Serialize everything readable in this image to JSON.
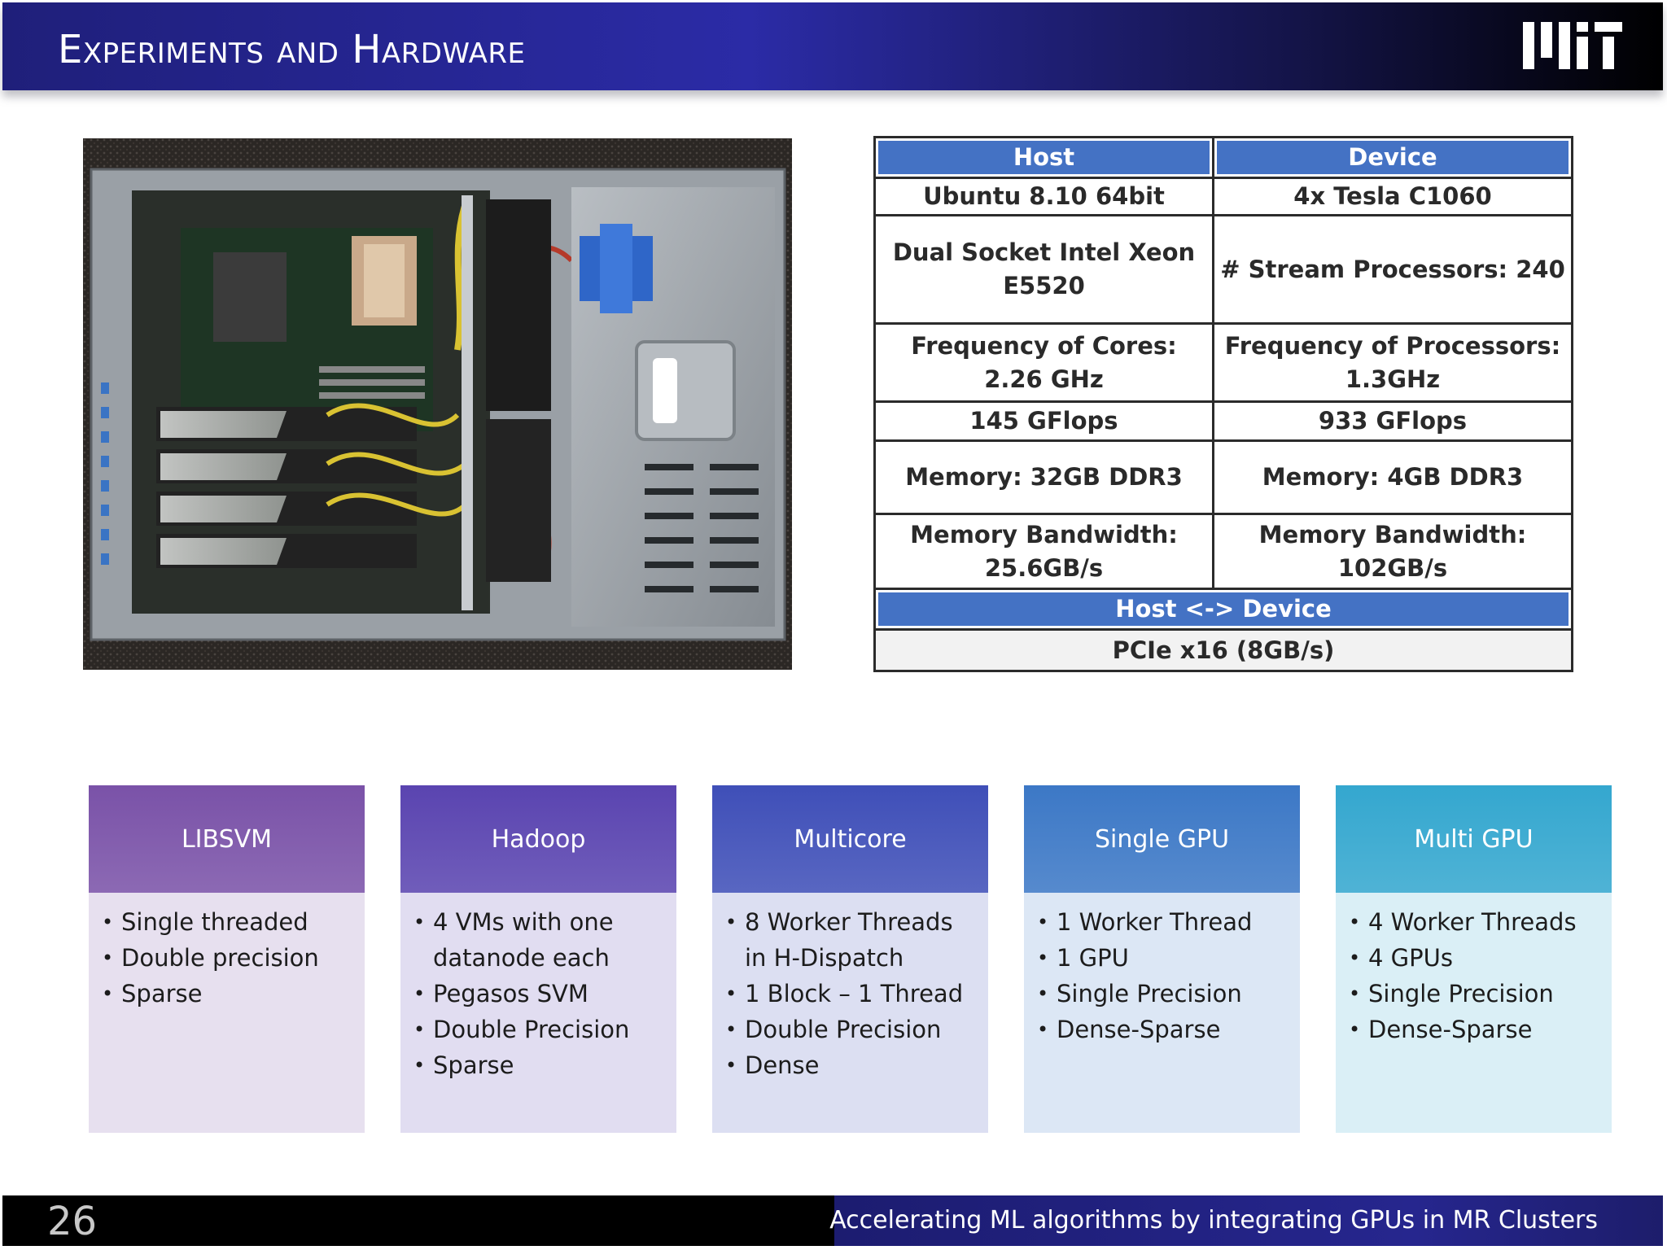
{
  "header": {
    "title": "Experiments and Hardware"
  },
  "spec_table": {
    "header_host": "Host",
    "header_device": "Device",
    "rows": [
      {
        "host": "Ubuntu 8.10 64bit",
        "device": "4x Tesla C1060"
      },
      {
        "host": "Dual Socket Intel Xeon E5520",
        "device": "# Stream Processors: 240"
      },
      {
        "host": "Frequency of Cores: 2.26 GHz",
        "device": "Frequency of Processors: 1.3GHz"
      },
      {
        "host": "145 GFlops",
        "device": "933 GFlops"
      },
      {
        "host": "Memory: 32GB DDR3",
        "device": "Memory: 4GB DDR3"
      },
      {
        "host": "Memory Bandwidth: 25.6GB/s",
        "device": "Memory Bandwidth: 102GB/s"
      }
    ],
    "link_header": "Host <-> Device",
    "link_value": "PCIe x16 (8GB/s)"
  },
  "columns": [
    {
      "title": "LIBSVM",
      "color": "#7a52a8",
      "items": [
        "Single threaded",
        "Double precision",
        "Sparse"
      ]
    },
    {
      "title": "Hadoop",
      "color": "#5a44b0",
      "items": [
        "4 VMs with one datanode each",
        "Pegasos SVM",
        "Double Precision",
        "Sparse"
      ]
    },
    {
      "title": "Multicore",
      "color": "#3f4fb8",
      "items": [
        "8 Worker Threads in H-Dispatch",
        "1 Block – 1 Thread",
        "Double Precision",
        "Dense"
      ]
    },
    {
      "title": "Single GPU",
      "color": "#3c78c6",
      "items": [
        "1 Worker Thread",
        "1 GPU",
        "Single Precision",
        "Dense-Sparse"
      ]
    },
    {
      "title": "Multi GPU",
      "color": "#34a7cf",
      "items": [
        "4 Worker Threads",
        "4 GPUs",
        "Single Precision",
        "Dense-Sparse"
      ]
    }
  ],
  "footer": {
    "slide_number": "26",
    "caption": "Accelerating ML algorithms by integrating GPUs in MR Clusters"
  }
}
